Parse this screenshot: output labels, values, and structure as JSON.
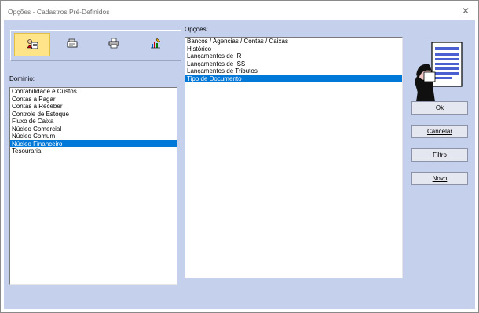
{
  "window": {
    "title": "Opções - Cadastros Pré-Definidos"
  },
  "toolbar": {
    "tools": [
      {
        "icon": "user-card-icon",
        "active": true
      },
      {
        "icon": "cash-register-icon",
        "active": false
      },
      {
        "icon": "printer-icon",
        "active": false
      },
      {
        "icon": "chart-tools-icon",
        "active": false
      }
    ]
  },
  "dominio": {
    "label": "Domínio:",
    "items": [
      "Contabilidade e Custos",
      "Contas a Pagar",
      "Contas a Receber",
      "Controle de Estoque",
      "Fluxo de Caixa",
      "Núcleo Comercial",
      "Núcleo Comum",
      "Núcleo Financeiro",
      "Tesouraria"
    ],
    "selected_index": 7
  },
  "opcoes": {
    "label": "Opções:",
    "items": [
      "Bancos / Agencias / Contas / Caixas",
      "Histórico",
      "Lançamentos de IR",
      "Lançamentos de ISS",
      "Lançamentos de Tributos",
      "Tipo de Documento"
    ],
    "selected_index": 5
  },
  "buttons": {
    "ok": "Ok",
    "cancelar": "Cancelar",
    "filtro": "Filtro",
    "novo": "Novo"
  },
  "colors": {
    "client_bg": "#c4d0ec",
    "selection": "#0078d7",
    "active_tool": "#ffe48a"
  }
}
